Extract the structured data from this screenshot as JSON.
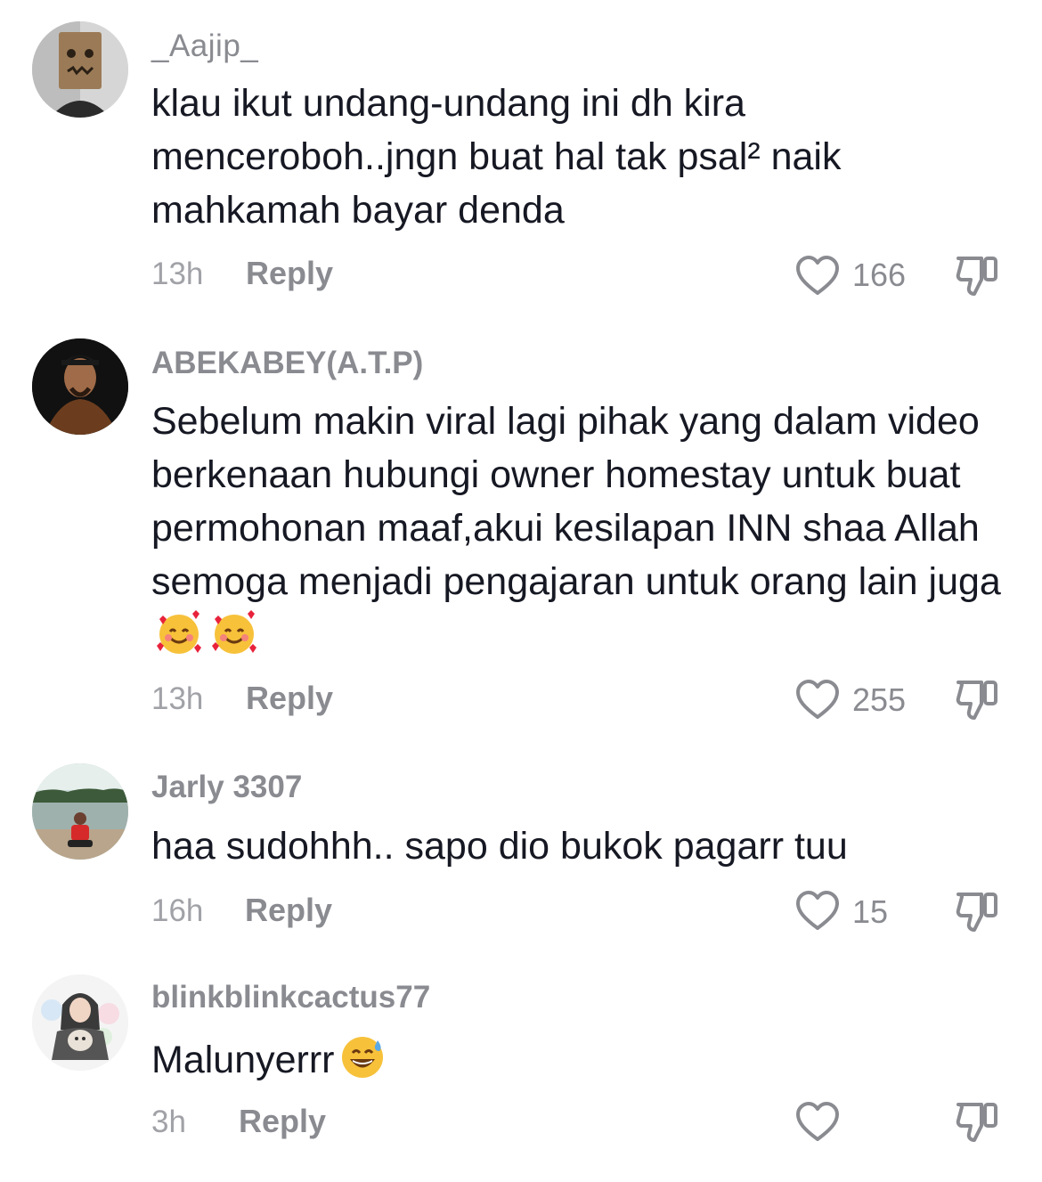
{
  "comments": [
    {
      "username": "_Aajip_",
      "text": "klau ikut undang-undang ini dh kira menceroboh..jngn buat hal tak psal² naik mahkamah bayar denda",
      "time": "13h",
      "reply_label": "Reply",
      "likes": "166",
      "avatar": "paper-bag-face-avatar"
    },
    {
      "username": "ABEKABEY(A.T.P)",
      "text": "Sebelum makin viral lagi pihak yang dalam video berkenaan hubungi owner homestay untuk buat permohonan maaf,akui kesilapan INN shaa Allah semoga menjadi pengajaran untuk orang lain juga",
      "emojis": [
        "smiling-face-with-hearts",
        "smiling-face-with-hearts"
      ],
      "time": "13h",
      "reply_label": "Reply",
      "likes": "255",
      "avatar": "man-portrait-avatar"
    },
    {
      "username": "Jarly 3307",
      "text": "haa sudohhh.. sapo dio bukok pagarr tuu",
      "time": "16h",
      "reply_label": "Reply",
      "likes": "15",
      "avatar": "person-at-lake-avatar"
    },
    {
      "username": "blinkblinkcactus77",
      "text": "Malunyerrr",
      "emojis": [
        "grinning-face-with-sweat"
      ],
      "time": "3h",
      "reply_label": "Reply",
      "likes": "",
      "avatar": "girl-with-cat-avatar"
    }
  ],
  "colors": {
    "text": "#161823",
    "secondary": "#8a8b91",
    "icon": "#8a8b91"
  }
}
